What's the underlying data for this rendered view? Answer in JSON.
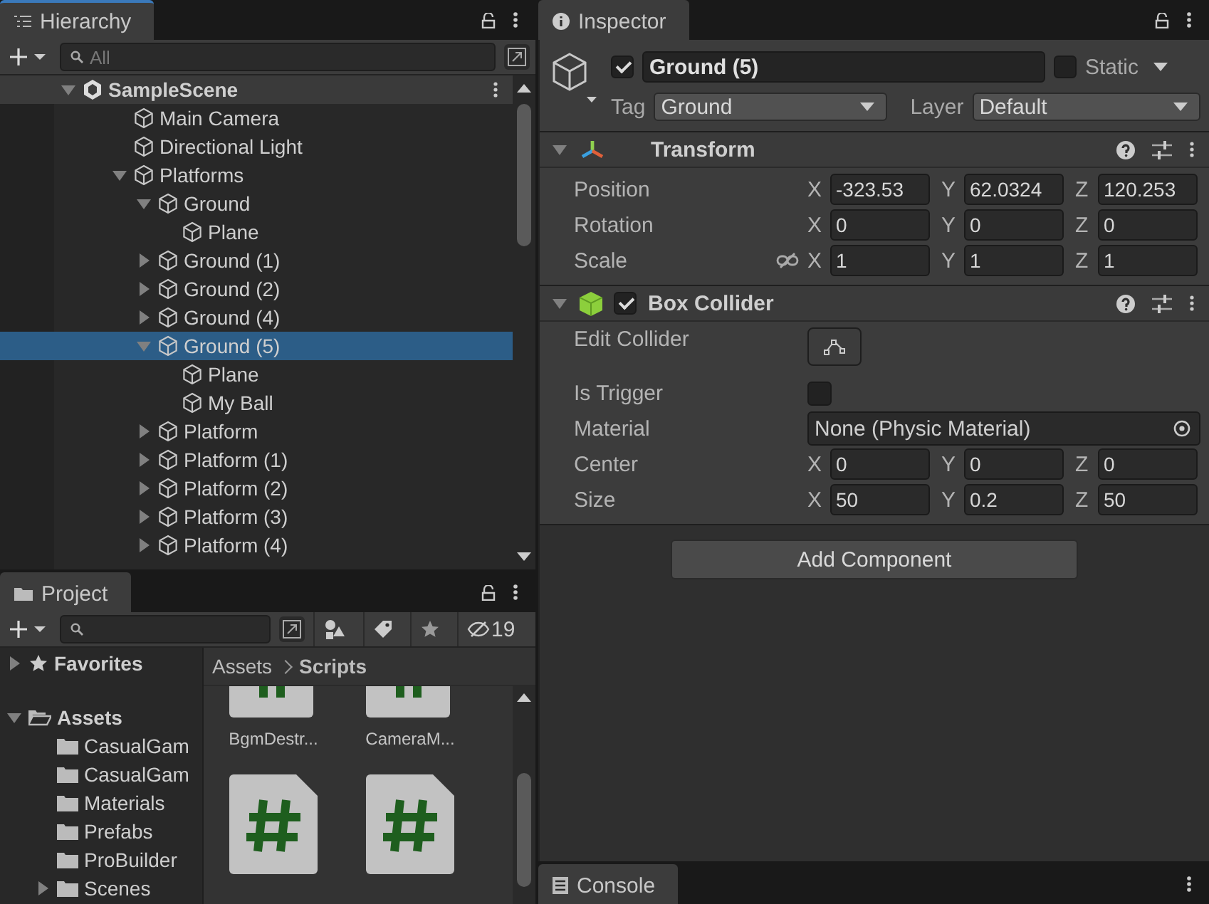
{
  "hierarchy": {
    "tab": "Hierarchy",
    "search": {
      "placeholder": "All"
    },
    "scene": {
      "name": "SampleScene",
      "expanded": true,
      "children": [
        {
          "name": "Main Camera",
          "selected": false
        },
        {
          "name": "Directional Light",
          "selected": false
        },
        {
          "name": "Platforms",
          "selected": false,
          "expanded": true,
          "children": [
            {
              "name": "Ground",
              "selected": false,
              "expanded": true,
              "children": [
                {
                  "name": "Plane",
                  "selected": false
                }
              ]
            },
            {
              "name": "Ground (1)",
              "selected": false,
              "expanded": false
            },
            {
              "name": "Ground (2)",
              "selected": false,
              "expanded": false
            },
            {
              "name": "Ground (4)",
              "selected": false,
              "expanded": false
            },
            {
              "name": "Ground (5)",
              "selected": true,
              "expanded": true,
              "children": [
                {
                  "name": "Plane",
                  "selected": false
                },
                {
                  "name": "My Ball",
                  "selected": false
                }
              ]
            },
            {
              "name": "Platform",
              "selected": false,
              "expanded": false
            },
            {
              "name": "Platform (1)",
              "selected": false,
              "expanded": false
            },
            {
              "name": "Platform (2)",
              "selected": false,
              "expanded": false
            },
            {
              "name": "Platform (3)",
              "selected": false,
              "expanded": false
            },
            {
              "name": "Platform (4)",
              "selected": false,
              "expanded": false
            }
          ]
        }
      ]
    }
  },
  "project": {
    "tab": "Project",
    "hidden_count": "19",
    "tree": [
      {
        "name": "Favorites",
        "kind": "favorites",
        "selected": false,
        "expanded": false
      },
      {
        "name": "Assets",
        "kind": "folder",
        "selected": false,
        "expanded": true,
        "children": [
          {
            "name": "CasualGam",
            "kind": "folder",
            "selected": false
          },
          {
            "name": "CasualGam",
            "kind": "folder",
            "selected": false
          },
          {
            "name": "Materials",
            "kind": "folder",
            "selected": false
          },
          {
            "name": "Prefabs",
            "kind": "folder",
            "selected": false
          },
          {
            "name": "ProBuilder",
            "kind": "folder",
            "selected": false
          },
          {
            "name": "Scenes",
            "kind": "folder",
            "selected": false,
            "expanded": false
          }
        ]
      }
    ],
    "breadcrumb": [
      "Assets",
      "Scripts"
    ],
    "files": [
      {
        "name": "BgmDestr...",
        "selected": false
      },
      {
        "name": "CameraM...",
        "selected": false
      }
    ]
  },
  "inspector": {
    "tab": "Inspector",
    "object": {
      "enabled": true,
      "name": "Ground (5)",
      "static": false,
      "static_label": "Static",
      "tag_label": "Tag",
      "tag": "Ground",
      "layer_label": "Layer",
      "layer": "Default"
    },
    "components": [
      {
        "kind": "transform",
        "title": "Transform",
        "expanded": true,
        "rows": [
          {
            "kind": "vector",
            "label": "Position",
            "values": [
              {
                "axis": "X",
                "value": "-323.53"
              },
              {
                "axis": "Y",
                "value": "62.0324"
              },
              {
                "axis": "Z",
                "value": "120.253"
              }
            ]
          },
          {
            "kind": "vector",
            "label": "Rotation",
            "values": [
              {
                "axis": "X",
                "value": "0"
              },
              {
                "axis": "Y",
                "value": "0"
              },
              {
                "axis": "Z",
                "value": "0"
              }
            ]
          },
          {
            "kind": "vector",
            "label": "Scale",
            "constrained": false,
            "values": [
              {
                "axis": "X",
                "value": "1"
              },
              {
                "axis": "Y",
                "value": "1"
              },
              {
                "axis": "Z",
                "value": "1"
              }
            ]
          }
        ]
      },
      {
        "kind": "box_collider",
        "title": "Box Collider",
        "enabled": true,
        "expanded": true,
        "rows": [
          {
            "kind": "edit_button",
            "label": "Edit Collider"
          },
          {
            "kind": "checkbox",
            "label": "Is Trigger",
            "checked": false
          },
          {
            "kind": "object",
            "label": "Material",
            "value": "None (Physic Material)"
          },
          {
            "kind": "vector",
            "label": "Center",
            "values": [
              {
                "axis": "X",
                "value": "0"
              },
              {
                "axis": "Y",
                "value": "0"
              },
              {
                "axis": "Z",
                "value": "0"
              }
            ]
          },
          {
            "kind": "vector",
            "label": "Size",
            "values": [
              {
                "axis": "X",
                "value": "50"
              },
              {
                "axis": "Y",
                "value": "0.2"
              },
              {
                "axis": "Z",
                "value": "50"
              }
            ]
          }
        ]
      }
    ],
    "add_component": "Add Component"
  },
  "console": {
    "tab": "Console"
  }
}
